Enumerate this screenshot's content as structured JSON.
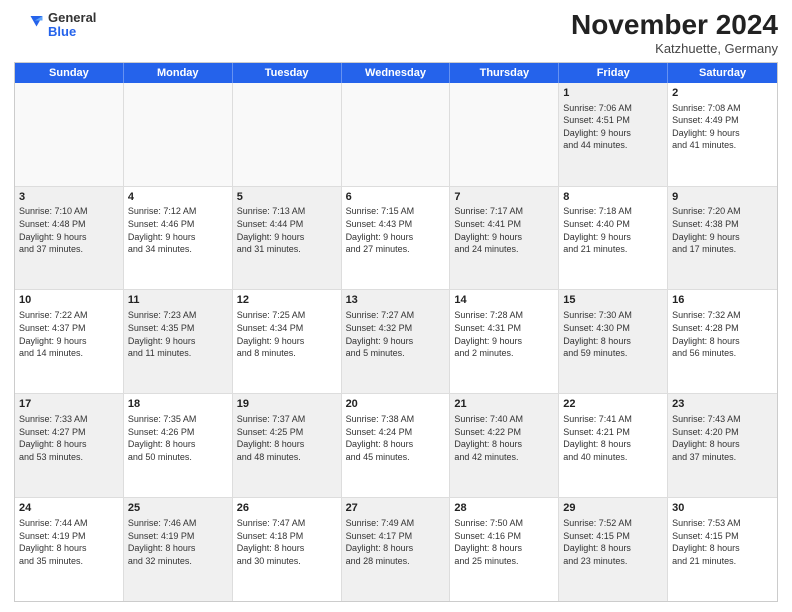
{
  "header": {
    "logo": {
      "general": "General",
      "blue": "Blue"
    },
    "title": "November 2024",
    "location": "Katzhuette, Germany"
  },
  "weekdays": [
    "Sunday",
    "Monday",
    "Tuesday",
    "Wednesday",
    "Thursday",
    "Friday",
    "Saturday"
  ],
  "weeks": [
    [
      {
        "day": "",
        "info": "",
        "empty": true
      },
      {
        "day": "",
        "info": "",
        "empty": true
      },
      {
        "day": "",
        "info": "",
        "empty": true
      },
      {
        "day": "",
        "info": "",
        "empty": true
      },
      {
        "day": "",
        "info": "",
        "empty": true
      },
      {
        "day": "1",
        "info": "Sunrise: 7:06 AM\nSunset: 4:51 PM\nDaylight: 9 hours\nand 44 minutes.",
        "shaded": true
      },
      {
        "day": "2",
        "info": "Sunrise: 7:08 AM\nSunset: 4:49 PM\nDaylight: 9 hours\nand 41 minutes.",
        "shaded": false
      }
    ],
    [
      {
        "day": "3",
        "info": "Sunrise: 7:10 AM\nSunset: 4:48 PM\nDaylight: 9 hours\nand 37 minutes.",
        "shaded": true
      },
      {
        "day": "4",
        "info": "Sunrise: 7:12 AM\nSunset: 4:46 PM\nDaylight: 9 hours\nand 34 minutes.",
        "shaded": false
      },
      {
        "day": "5",
        "info": "Sunrise: 7:13 AM\nSunset: 4:44 PM\nDaylight: 9 hours\nand 31 minutes.",
        "shaded": true
      },
      {
        "day": "6",
        "info": "Sunrise: 7:15 AM\nSunset: 4:43 PM\nDaylight: 9 hours\nand 27 minutes.",
        "shaded": false
      },
      {
        "day": "7",
        "info": "Sunrise: 7:17 AM\nSunset: 4:41 PM\nDaylight: 9 hours\nand 24 minutes.",
        "shaded": true
      },
      {
        "day": "8",
        "info": "Sunrise: 7:18 AM\nSunset: 4:40 PM\nDaylight: 9 hours\nand 21 minutes.",
        "shaded": false
      },
      {
        "day": "9",
        "info": "Sunrise: 7:20 AM\nSunset: 4:38 PM\nDaylight: 9 hours\nand 17 minutes.",
        "shaded": true
      }
    ],
    [
      {
        "day": "10",
        "info": "Sunrise: 7:22 AM\nSunset: 4:37 PM\nDaylight: 9 hours\nand 14 minutes.",
        "shaded": false
      },
      {
        "day": "11",
        "info": "Sunrise: 7:23 AM\nSunset: 4:35 PM\nDaylight: 9 hours\nand 11 minutes.",
        "shaded": true
      },
      {
        "day": "12",
        "info": "Sunrise: 7:25 AM\nSunset: 4:34 PM\nDaylight: 9 hours\nand 8 minutes.",
        "shaded": false
      },
      {
        "day": "13",
        "info": "Sunrise: 7:27 AM\nSunset: 4:32 PM\nDaylight: 9 hours\nand 5 minutes.",
        "shaded": true
      },
      {
        "day": "14",
        "info": "Sunrise: 7:28 AM\nSunset: 4:31 PM\nDaylight: 9 hours\nand 2 minutes.",
        "shaded": false
      },
      {
        "day": "15",
        "info": "Sunrise: 7:30 AM\nSunset: 4:30 PM\nDaylight: 8 hours\nand 59 minutes.",
        "shaded": true
      },
      {
        "day": "16",
        "info": "Sunrise: 7:32 AM\nSunset: 4:28 PM\nDaylight: 8 hours\nand 56 minutes.",
        "shaded": false
      }
    ],
    [
      {
        "day": "17",
        "info": "Sunrise: 7:33 AM\nSunset: 4:27 PM\nDaylight: 8 hours\nand 53 minutes.",
        "shaded": true
      },
      {
        "day": "18",
        "info": "Sunrise: 7:35 AM\nSunset: 4:26 PM\nDaylight: 8 hours\nand 50 minutes.",
        "shaded": false
      },
      {
        "day": "19",
        "info": "Sunrise: 7:37 AM\nSunset: 4:25 PM\nDaylight: 8 hours\nand 48 minutes.",
        "shaded": true
      },
      {
        "day": "20",
        "info": "Sunrise: 7:38 AM\nSunset: 4:24 PM\nDaylight: 8 hours\nand 45 minutes.",
        "shaded": false
      },
      {
        "day": "21",
        "info": "Sunrise: 7:40 AM\nSunset: 4:22 PM\nDaylight: 8 hours\nand 42 minutes.",
        "shaded": true
      },
      {
        "day": "22",
        "info": "Sunrise: 7:41 AM\nSunset: 4:21 PM\nDaylight: 8 hours\nand 40 minutes.",
        "shaded": false
      },
      {
        "day": "23",
        "info": "Sunrise: 7:43 AM\nSunset: 4:20 PM\nDaylight: 8 hours\nand 37 minutes.",
        "shaded": true
      }
    ],
    [
      {
        "day": "24",
        "info": "Sunrise: 7:44 AM\nSunset: 4:19 PM\nDaylight: 8 hours\nand 35 minutes.",
        "shaded": false
      },
      {
        "day": "25",
        "info": "Sunrise: 7:46 AM\nSunset: 4:19 PM\nDaylight: 8 hours\nand 32 minutes.",
        "shaded": true
      },
      {
        "day": "26",
        "info": "Sunrise: 7:47 AM\nSunset: 4:18 PM\nDaylight: 8 hours\nand 30 minutes.",
        "shaded": false
      },
      {
        "day": "27",
        "info": "Sunrise: 7:49 AM\nSunset: 4:17 PM\nDaylight: 8 hours\nand 28 minutes.",
        "shaded": true
      },
      {
        "day": "28",
        "info": "Sunrise: 7:50 AM\nSunset: 4:16 PM\nDaylight: 8 hours\nand 25 minutes.",
        "shaded": false
      },
      {
        "day": "29",
        "info": "Sunrise: 7:52 AM\nSunset: 4:15 PM\nDaylight: 8 hours\nand 23 minutes.",
        "shaded": true
      },
      {
        "day": "30",
        "info": "Sunrise: 7:53 AM\nSunset: 4:15 PM\nDaylight: 8 hours\nand 21 minutes.",
        "shaded": false
      }
    ]
  ]
}
